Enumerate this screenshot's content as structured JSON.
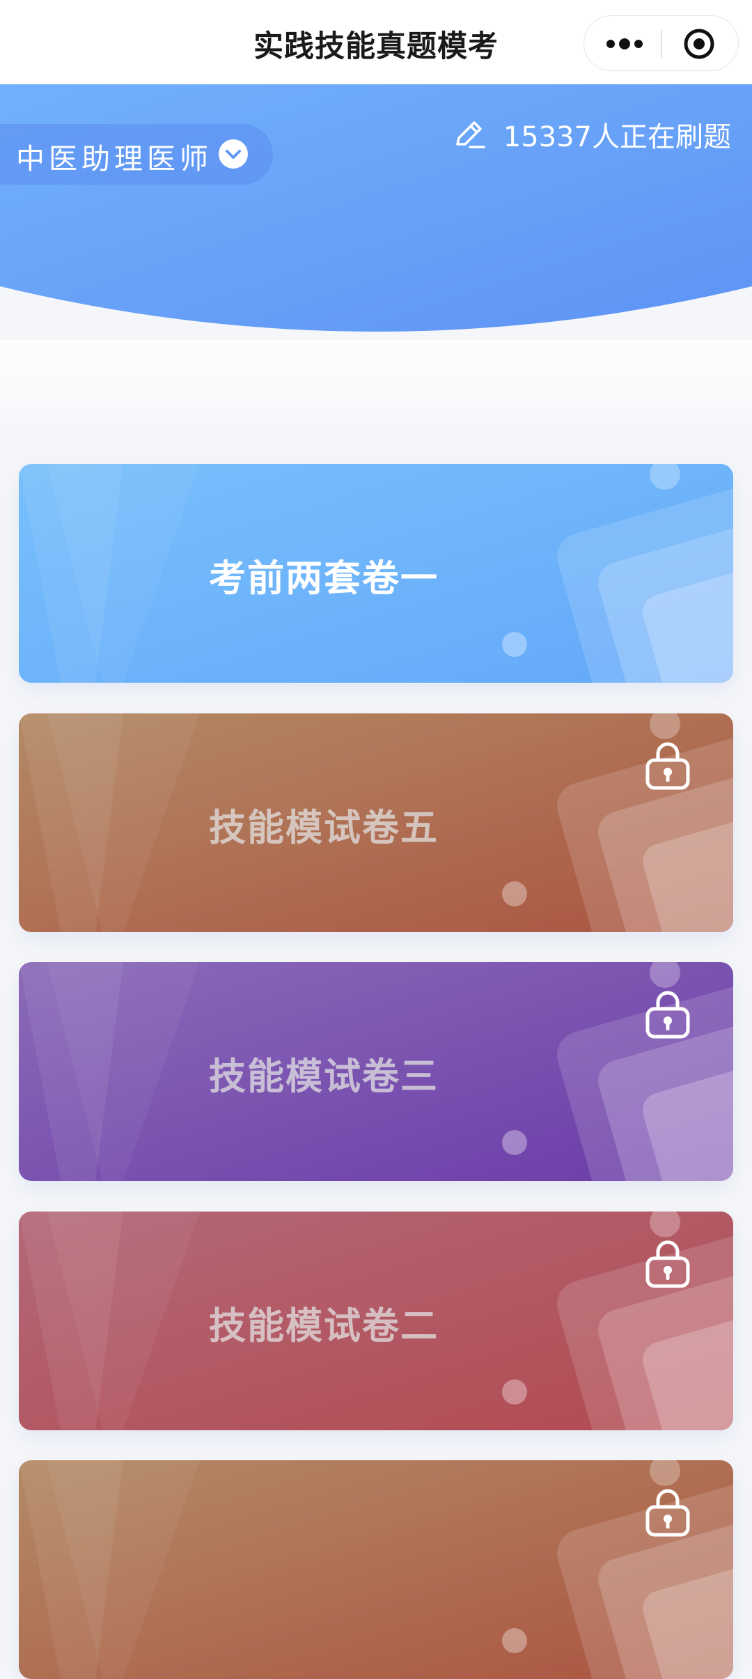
{
  "navbar": {
    "title": "实践技能真题模考",
    "more_icon": "more-dots-icon",
    "close_icon": "target-circle-icon"
  },
  "header": {
    "exam_type": "中医助理医师",
    "exam_dropdown_icon": "chevron-down-icon",
    "counter_icon": "pencil-edit-icon",
    "counter_text": "15337人正在刷题",
    "gradient": [
      "#6fb3fb",
      "#5f97f6"
    ]
  },
  "papers": [
    {
      "title": "考前两套卷一",
      "locked": false,
      "colors": [
        "#78c0fb",
        "#63a8fa"
      ]
    },
    {
      "title": "技能模试卷五",
      "locked": true,
      "colors": [
        "#b38a66",
        "#ab5440"
      ]
    },
    {
      "title": "技能模试卷三",
      "locked": true,
      "colors": [
        "#8a6bb8",
        "#6b3ba8"
      ]
    },
    {
      "title": "技能模试卷二",
      "locked": true,
      "colors": [
        "#b36878",
        "#b24a50"
      ]
    },
    {
      "title": "",
      "locked": true,
      "colors": [
        "#b38a66",
        "#ab5440"
      ]
    }
  ]
}
